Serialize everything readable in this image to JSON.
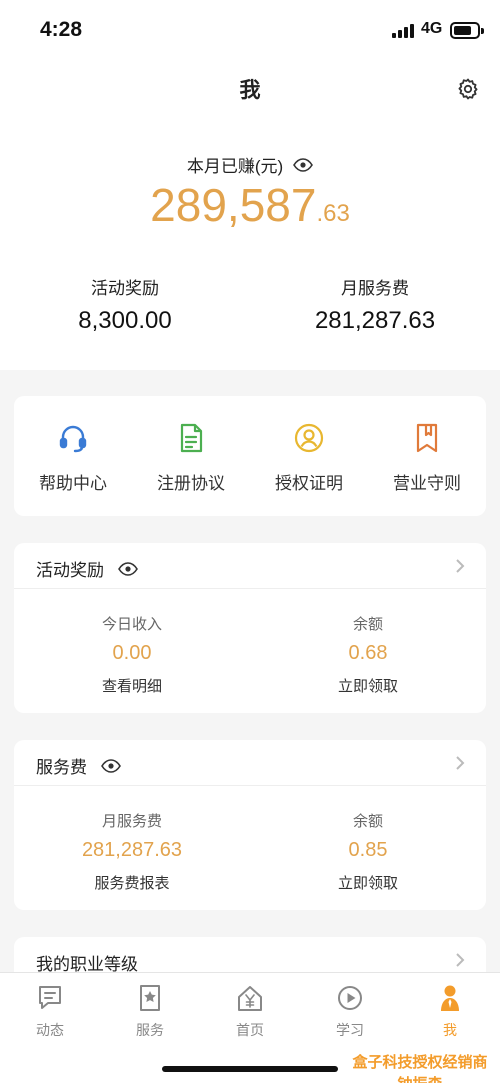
{
  "status": {
    "time": "4:28",
    "network": "4G"
  },
  "header": {
    "title": "我"
  },
  "earnings": {
    "label": "本月已赚(元)",
    "amount_int": "289,587",
    "amount_dec": ".63",
    "left_label": "活动奖励",
    "left_value": "8,300.00",
    "right_label": "月服务费",
    "right_value": "281,287.63"
  },
  "shortcuts": [
    {
      "label": "帮助中心",
      "icon": "headset-icon"
    },
    {
      "label": "注册协议",
      "icon": "document-icon"
    },
    {
      "label": "授权证明",
      "icon": "user-circle-icon"
    },
    {
      "label": "营业守则",
      "icon": "bookmark-icon"
    }
  ],
  "activity": {
    "title": "活动奖励",
    "left": {
      "label": "今日收入",
      "value": "0.00",
      "action": "查看明细"
    },
    "right": {
      "label": "余额",
      "value": "0.68",
      "action": "立即领取"
    }
  },
  "service": {
    "title": "服务费",
    "left": {
      "label": "月服务费",
      "value": "281,287.63",
      "action": "服务费报表"
    },
    "right": {
      "label": "余额",
      "value": "0.85",
      "action": "立即领取"
    }
  },
  "career": {
    "title": "我的职业等级"
  },
  "tabs": [
    {
      "label": "动态",
      "icon": "chat-icon"
    },
    {
      "label": "服务",
      "icon": "star-doc-icon"
    },
    {
      "label": "首页",
      "icon": "home-yuan-icon"
    },
    {
      "label": "学习",
      "icon": "play-icon"
    },
    {
      "label": "我",
      "icon": "person-icon"
    }
  ],
  "watermark": {
    "line1": "盒子科技授权经销商",
    "line2": "钟振森"
  },
  "colors": {
    "accent": "#e2a34d",
    "tab_active": "#f39c2b",
    "icon_blue": "#3a7bd5",
    "icon_green": "#4caf50",
    "icon_yellow": "#e8b730",
    "icon_orange": "#e07a3a"
  }
}
